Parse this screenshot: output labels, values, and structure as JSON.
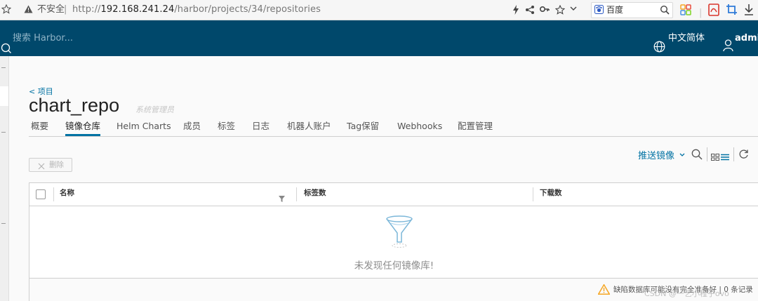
{
  "browser": {
    "security_label": "不安全",
    "url_prefix": "http://",
    "url_host": "192.168.241.24",
    "url_path": "/harbor/projects/34/repositories",
    "search_engine": "百度"
  },
  "header": {
    "search_placeholder": "搜索 Harbor...",
    "language": "中文简体",
    "user": "admin"
  },
  "page": {
    "back_link": "< 项目",
    "title": "chart_repo",
    "role": "系统管理员"
  },
  "tabs": [
    {
      "label": "概要"
    },
    {
      "label": "镜像仓库",
      "active": true
    },
    {
      "label": "Helm Charts"
    },
    {
      "label": "成员"
    },
    {
      "label": "标签"
    },
    {
      "label": "日志"
    },
    {
      "label": "机器人账户"
    },
    {
      "label": "Tag保留"
    },
    {
      "label": "Webhooks"
    },
    {
      "label": "配置管理"
    }
  ],
  "toolbar": {
    "delete_label": "删除",
    "push_label": "推送镜像"
  },
  "table": {
    "columns": [
      "名称",
      "标签数",
      "下载数"
    ],
    "empty_text": "未发现任何镜像库!",
    "footer_text": "缺陷数据库可能没有完全准备好 | 0 条记录"
  },
  "watermark": "CSDN @一艺小程子ovo",
  "colors": {
    "header_bg": "#00486b",
    "link": "#0072a3",
    "warning": "#f5a623"
  }
}
